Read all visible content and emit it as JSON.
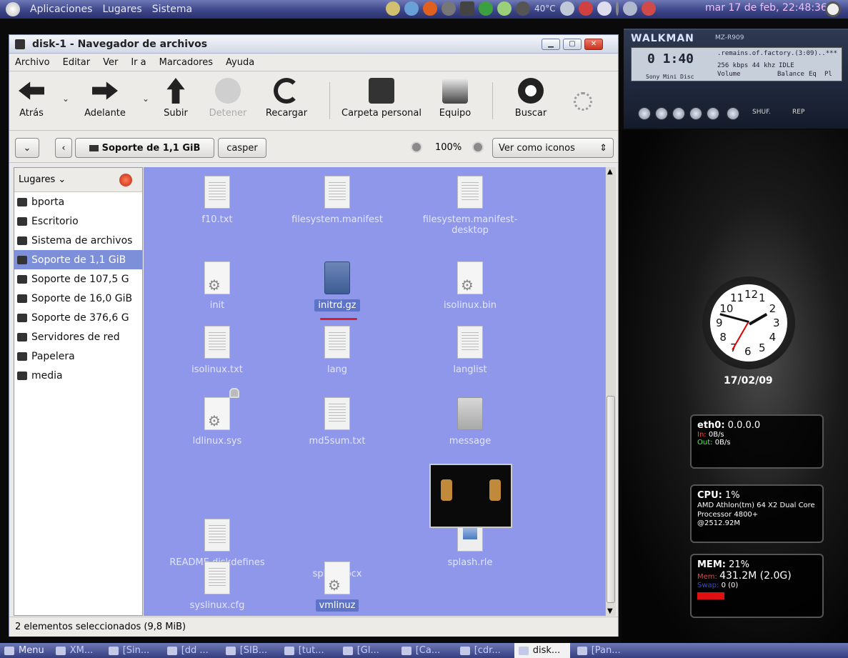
{
  "top_panel": {
    "menus": [
      "Aplicaciones",
      "Lugares",
      "Sistema"
    ],
    "temperature": "40°C",
    "clock": "mar 17 de feb, 22:48:36"
  },
  "window": {
    "title": "disk-1 - Navegador de archivos",
    "menubar": [
      "Archivo",
      "Editar",
      "Ver",
      "Ir a",
      "Marcadores",
      "Ayuda"
    ],
    "toolbar": {
      "back": "Atrás",
      "forward": "Adelante",
      "up": "Subir",
      "stop": "Detener",
      "reload": "Recargar",
      "home": "Carpeta personal",
      "computer": "Equipo",
      "search": "Buscar"
    },
    "location": {
      "current": "Soporte de 1,1 GiB",
      "next": "casper",
      "zoom": "100%",
      "view_mode": "Ver como iconos"
    },
    "sidebar": {
      "header": "Lugares",
      "items": [
        {
          "label": "bporta",
          "selected": false
        },
        {
          "label": "Escritorio",
          "selected": false
        },
        {
          "label": "Sistema de archivos",
          "selected": false
        },
        {
          "label": "Soporte de 1,1 GiB",
          "selected": true
        },
        {
          "label": "Soporte de 107,5 G",
          "selected": false
        },
        {
          "label": "Soporte de 16,0 GiB",
          "selected": false
        },
        {
          "label": "Soporte de 376,6 G",
          "selected": false
        },
        {
          "label": "Servidores de red",
          "selected": false
        },
        {
          "label": "Papelera",
          "selected": false
        },
        {
          "label": "media",
          "selected": false
        }
      ]
    },
    "files": [
      {
        "name": "f10.txt",
        "icon": "text-file-icon"
      },
      {
        "name": "filesystem.manifest",
        "icon": "text-file-icon"
      },
      {
        "name": "filesystem.manifest-desktop",
        "icon": "text-file-icon"
      },
      {
        "name": "init",
        "icon": "executable-file-icon"
      },
      {
        "name": "initrd.gz",
        "icon": "archive-file-icon",
        "selected": true
      },
      {
        "name": "isolinux.bin",
        "icon": "executable-file-icon"
      },
      {
        "name": "isolinux.txt",
        "icon": "text-file-icon"
      },
      {
        "name": "lang",
        "icon": "text-file-icon"
      },
      {
        "name": "langlist",
        "icon": "text-file-icon"
      },
      {
        "name": "ldlinux.sys",
        "icon": "locked-executable-file-icon"
      },
      {
        "name": "md5sum.txt",
        "icon": "text-file-icon"
      },
      {
        "name": "message",
        "icon": "generic-file-icon"
      },
      {
        "name": "README.diskdefines",
        "icon": "text-file-icon"
      },
      {
        "name": "splash.pcx",
        "icon": "image-thumbnail"
      },
      {
        "name": "splash.rle",
        "icon": "image-file-icon"
      },
      {
        "name": "syslinux.cfg",
        "icon": "text-file-icon"
      },
      {
        "name": "vmlinuz",
        "icon": "executable-file-icon",
        "selected": true
      }
    ],
    "status": "2 elementos seleccionados (9,8 MiB)"
  },
  "walkman": {
    "brand": "WALKMAN",
    "model": "MZ-R909",
    "time": "0 1:40",
    "track": ".remains.of.factory.(3:09)..***",
    "bitrate": "256 kbps  44 khz",
    "mode": "IDLE",
    "volume_label": "Volume",
    "balance_label": "Balance",
    "eq_label": "Eq",
    "pl_label": "Pl",
    "disc": "Sony Mini Disc",
    "shuffle": "SHUF.",
    "repeat": "REP"
  },
  "clock_widget": {
    "numbers": [
      "12",
      "1",
      "2",
      "3",
      "4",
      "5",
      "6",
      "7",
      "8",
      "9",
      "10",
      "11"
    ],
    "date": "17/02/09"
  },
  "monitors": {
    "net": {
      "iface": "eth0:",
      "ip": "0.0.0.0",
      "in_label": "In:",
      "in_value": "0B/s",
      "out_label": "Out:",
      "out_value": "0B/s"
    },
    "cpu": {
      "label": "CPU:",
      "value": "1%",
      "model": "AMD Athlon(tm) 64 X2 Dual Core Processor 4800+",
      "freq": "@2512.92M"
    },
    "mem": {
      "label": "MEM:",
      "value": "21%",
      "mem_label": "Mem:",
      "mem_value": "431.2M (2.0G)",
      "swap_label": "Swap:",
      "swap_value": "0 (0)"
    }
  },
  "taskbar": {
    "menu": "Menu",
    "tasks": [
      "XM...",
      "[Sin...",
      "[dd ...",
      "[SIB...",
      "[tut...",
      "[Gl...",
      "[Ca...",
      "[cdr...",
      "disk...",
      "[Pan..."
    ],
    "active_index": 8
  },
  "colors": {
    "iconview_bg": "#8e97ea",
    "selection": "#7d8fd8",
    "panel": "#3d4688"
  }
}
